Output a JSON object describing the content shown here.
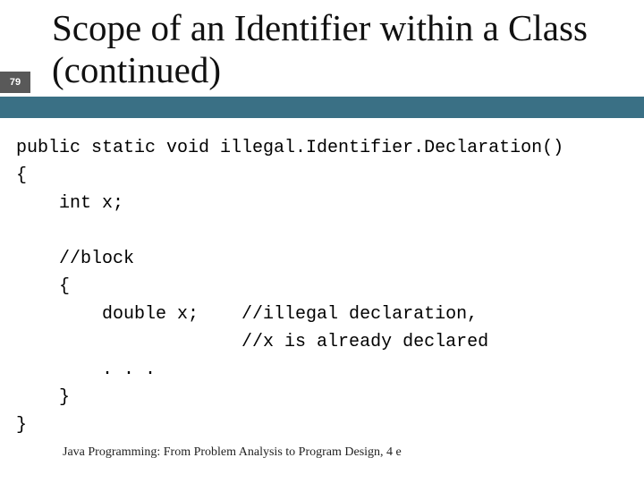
{
  "page_number": "79",
  "title": "Scope of an Identifier within a Class (continued)",
  "code": {
    "l1": "public static void illegal.Identifier.Declaration()",
    "l2": "{",
    "l3": "    int x;",
    "l4": "",
    "l5": "    //block",
    "l6": "    {",
    "l7": "        double x;    //illegal declaration,",
    "l8": "                     //x is already declared",
    "l9": "        . . .",
    "l10": "    }",
    "l11": "}"
  },
  "footer": "Java Programming: From Problem Analysis to Program Design, 4 e"
}
